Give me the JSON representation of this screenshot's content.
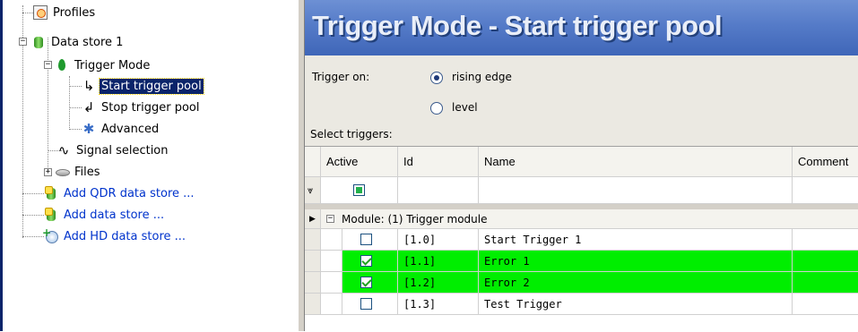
{
  "tree": {
    "items": [
      {
        "label": "Profiles",
        "icon": "profiles-icon",
        "link": false
      },
      {
        "label": "Data store 1",
        "icon": "datastore-icon",
        "link": false
      },
      {
        "label": "Trigger Mode",
        "icon": "trigger-mode-icon",
        "link": false
      },
      {
        "label": "Start trigger pool",
        "icon": "start-arrow-icon",
        "link": false,
        "selected": true
      },
      {
        "label": "Stop trigger pool",
        "icon": "stop-arrow-icon",
        "link": false
      },
      {
        "label": "Advanced",
        "icon": "gear-icon",
        "link": false
      },
      {
        "label": "Signal selection",
        "icon": "signal-wave-icon",
        "link": false
      },
      {
        "label": "Files",
        "icon": "disk-icon",
        "link": false
      },
      {
        "label": "Add QDR data store ...",
        "icon": "add-qdr-datastore-icon",
        "link": true
      },
      {
        "label": "Add data store ...",
        "icon": "add-datastore-icon",
        "link": true
      },
      {
        "label": "Add HD data store ...",
        "icon": "add-hd-datastore-icon",
        "link": true
      }
    ],
    "expanders": {
      "datastore": "−",
      "trigger_mode": "−",
      "files": "+"
    }
  },
  "header": {
    "title": "Trigger Mode - Start trigger pool"
  },
  "form": {
    "trigger_on_label": "Trigger on:",
    "rising_edge_label": "rising edge",
    "level_label": "level",
    "selected_option": "rising edge",
    "select_triggers_label": "Select triggers:"
  },
  "grid": {
    "columns": [
      "Active",
      "Id",
      "Name",
      "Comment"
    ],
    "group_label": "Module: (1) Trigger module",
    "group_expander": "−",
    "rows": [
      {
        "active": false,
        "id": "[1.0]",
        "name": "Start Trigger 1",
        "highlighted": false
      },
      {
        "active": true,
        "id": "[1.1]",
        "name": "Error 1",
        "highlighted": true
      },
      {
        "active": true,
        "id": "[1.2]",
        "name": "Error 2",
        "highlighted": true
      },
      {
        "active": false,
        "id": "[1.3]",
        "name": "Test Trigger",
        "highlighted": false
      }
    ]
  },
  "colors": {
    "highlight": "#00ee00",
    "banner": "#557bc8",
    "selection": "#0a246a",
    "link": "#0033cc"
  }
}
